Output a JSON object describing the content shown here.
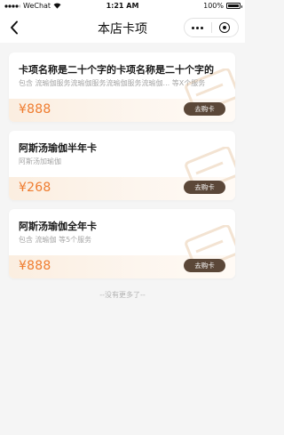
{
  "status_bar": {
    "carrier": "WeChat",
    "time": "1:21 AM",
    "battery": "100%"
  },
  "nav": {
    "title": "本店卡项"
  },
  "cards": [
    {
      "name": "卡项名称是二十个字的卡项名称是二十个字的",
      "description": "包含 流瑜伽服务流瑜伽服务流瑜伽服务流瑜伽... 等X个服务",
      "price": "¥888",
      "buy_label": "去购卡"
    },
    {
      "name": "阿斯汤瑜伽半年卡",
      "description": "阿斯汤加瑜伽",
      "price": "¥268",
      "buy_label": "去购卡"
    },
    {
      "name": "阿斯汤瑜伽全年卡",
      "description": "包含 流瑜伽 等5个服务",
      "price": "¥888",
      "buy_label": "去购卡"
    }
  ],
  "footer": {
    "no_more": "--没有更多了--"
  },
  "colors": {
    "accent_price": "#ef7c2f",
    "button_bg": "#5b4738",
    "page_bg": "#f5f5f5"
  }
}
